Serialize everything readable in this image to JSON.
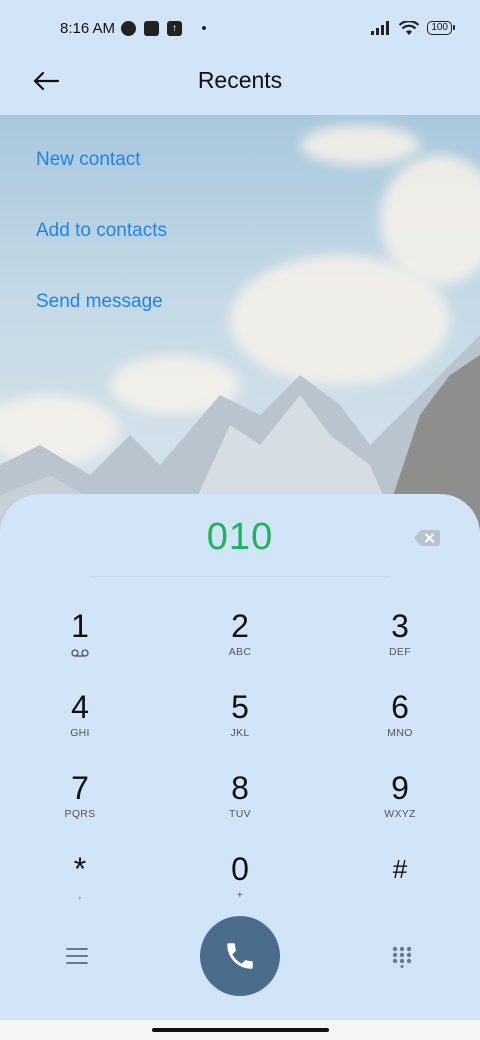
{
  "status_bar": {
    "time": "8:16 AM",
    "battery": "100",
    "icons": [
      "notification-app-icon",
      "square-notification-icon",
      "upload-notification-icon",
      "dot-icon",
      "signal-icon",
      "wifi-icon",
      "battery-icon"
    ]
  },
  "header": {
    "title": "Recents",
    "back_icon": "arrow-left-icon"
  },
  "menu": {
    "items": [
      "New contact",
      "Add to contacts",
      "Send message"
    ]
  },
  "dialer": {
    "number": "010",
    "backspace_icon": "backspace-icon",
    "keys": [
      {
        "digit": "1",
        "letters": ""
      },
      {
        "digit": "2",
        "letters": "ABC"
      },
      {
        "digit": "3",
        "letters": "DEF"
      },
      {
        "digit": "4",
        "letters": "GHI"
      },
      {
        "digit": "5",
        "letters": "JKL"
      },
      {
        "digit": "6",
        "letters": "MNO"
      },
      {
        "digit": "7",
        "letters": "PQRS"
      },
      {
        "digit": "8",
        "letters": "TUV"
      },
      {
        "digit": "9",
        "letters": "WXYZ"
      },
      {
        "digit": "*",
        "letters": ","
      },
      {
        "digit": "0",
        "letters": "+"
      },
      {
        "digit": "#",
        "letters": ""
      }
    ],
    "bottom": {
      "menu_icon": "hamburger-menu-icon",
      "call_icon": "phone-icon",
      "keypad_icon": "dialpad-icon"
    }
  },
  "colors": {
    "accent_link": "#1a86e8",
    "number_green": "#1eb35c",
    "call_button": "#4a6d8c",
    "panel_bg": "#d2e4f8"
  }
}
